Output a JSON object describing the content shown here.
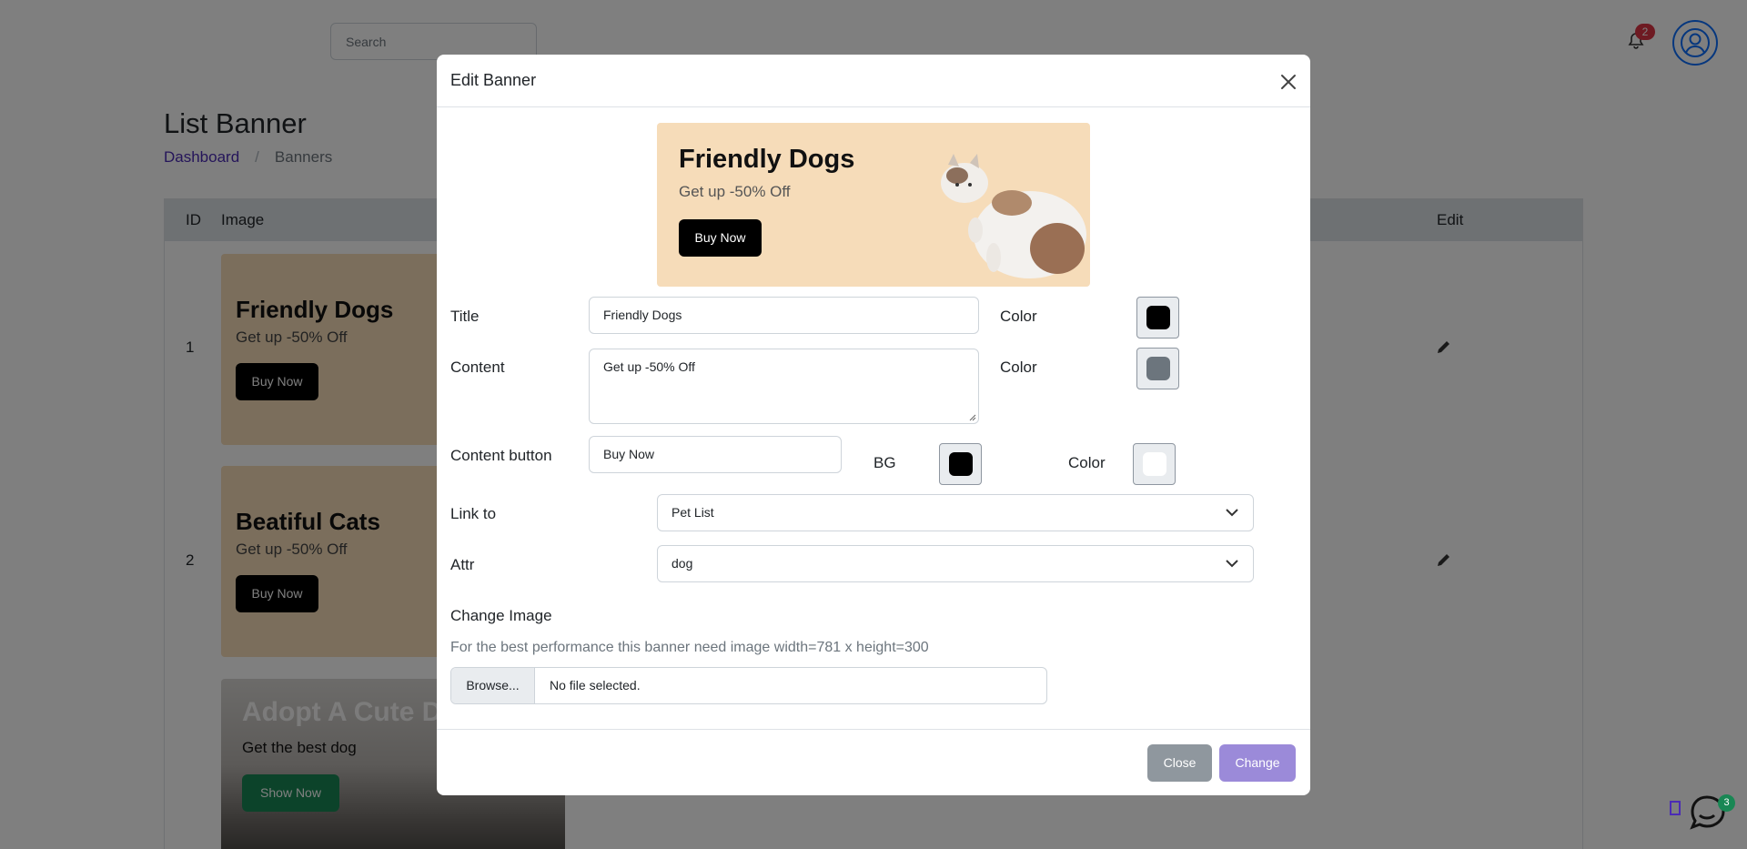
{
  "topbar": {
    "search_placeholder": "Search",
    "notifications_count": "2"
  },
  "page": {
    "title": "List Banner",
    "breadcrumb": {
      "link": "Dashboard",
      "separator": "/",
      "current": "Banners"
    }
  },
  "table": {
    "headers": {
      "id": "ID",
      "image": "Image",
      "edit": "Edit"
    },
    "rows": [
      {
        "id": "1",
        "title": "Friendly Dogs",
        "content": "Get up -50% Off",
        "button": "Buy Now"
      },
      {
        "id": "2",
        "title": "Beatiful Cats",
        "content": "Get up -50% Off",
        "button": "Buy Now"
      },
      {
        "id": "",
        "title": "Adopt A Cute Do",
        "content": "Get the best dog",
        "button": "Show Now"
      }
    ]
  },
  "modal": {
    "title": "Edit Banner",
    "preview": {
      "title": "Friendly Dogs",
      "content": "Get up -50% Off",
      "button": "Buy Now"
    },
    "fields": {
      "title_label": "Title",
      "title_value": "Friendly Dogs",
      "title_color_label": "Color",
      "title_color": "#000000",
      "content_label": "Content",
      "content_value": "Get up -50% Off",
      "content_color_label": "Color",
      "content_color": "#6c757d",
      "button_label": "Content button",
      "button_value": "Buy Now",
      "button_bg_label": "BG",
      "button_bg": "#000000",
      "button_color_label": "Color",
      "button_color": "#ffffff",
      "link_label": "Link to",
      "link_value": "Pet List",
      "attr_label": "Attr",
      "attr_value": "dog",
      "image_label": "Change Image",
      "image_hint": "For the best performance this banner need image width=781 x height=300",
      "browse_label": "Browse...",
      "file_status": "No file selected."
    },
    "footer": {
      "close_label": "Close",
      "change_label": "Change"
    }
  },
  "chat": {
    "badge": "3"
  },
  "colors": {
    "accent": "#4b2bb5",
    "banner_bg": "#f6dcb9",
    "close_btn": "#8f979e",
    "change_btn": "#9b8ad9",
    "success": "#198754",
    "danger": "#dc3545"
  }
}
